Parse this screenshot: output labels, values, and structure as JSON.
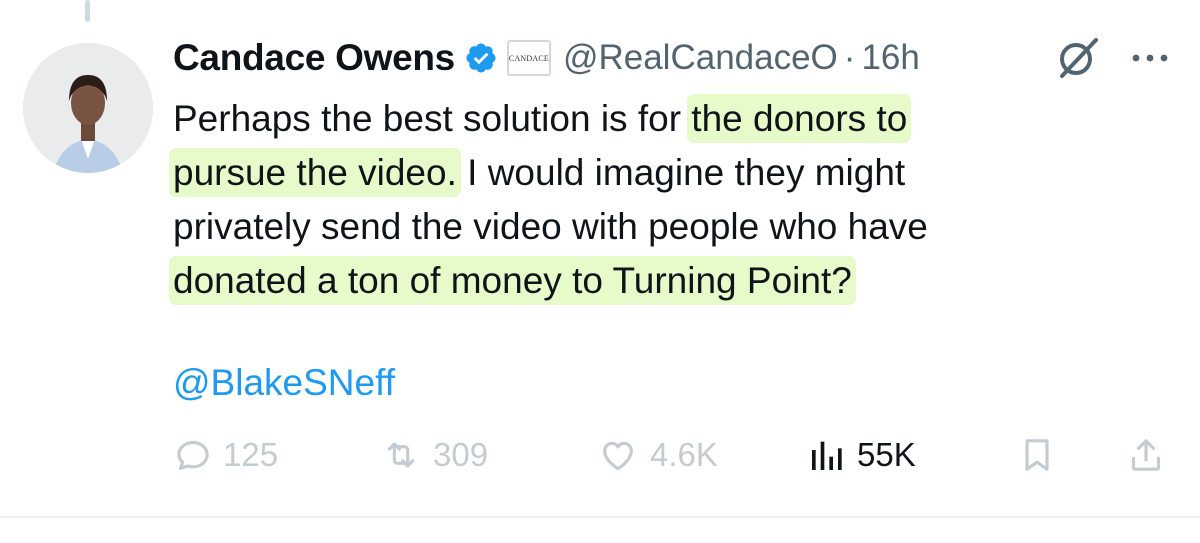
{
  "tweet": {
    "author": {
      "display_name": "Candace Owens",
      "handle": "@RealCandaceO",
      "affiliate_label": "CANDACE"
    },
    "separator": "·",
    "timestamp": "16h",
    "body": {
      "line1_plain": "Perhaps the best solution is for ",
      "line1_highlight": "the donors to",
      "line2_highlight": "pursue the video.",
      "line2_plain": " I would imagine they might",
      "line3_plain": "privately send the video with people who have",
      "line4_highlight": "donated a ton of money to Turning Point?"
    },
    "mention": "@BlakeSNeff",
    "metrics": {
      "replies": "125",
      "reposts": "309",
      "likes": "4.6K",
      "views": "55K"
    }
  },
  "colors": {
    "highlight": "#e6fbc9",
    "link": "#1d9bf0",
    "muted": "#536471",
    "verified": "#1d9bf0"
  }
}
